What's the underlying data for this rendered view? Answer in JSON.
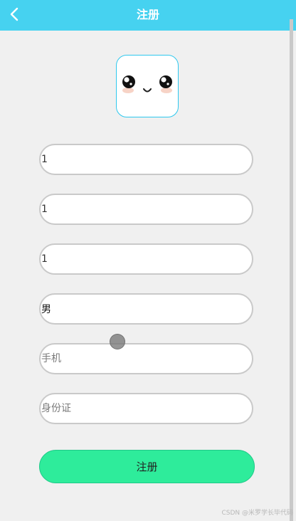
{
  "header": {
    "title": "注册",
    "background": "#46d2f0",
    "back_icon": "chevron-left-icon"
  },
  "avatar": {
    "icon": "cute-face-icon",
    "border_color": "#2ec8ee"
  },
  "form": {
    "fields": [
      {
        "value": "1",
        "placeholder": ""
      },
      {
        "value": "1",
        "placeholder": ""
      },
      {
        "value": "1",
        "placeholder": ""
      },
      {
        "value": "男",
        "placeholder": ""
      },
      {
        "value": "",
        "placeholder": "手机"
      },
      {
        "value": "",
        "placeholder": "身份证"
      }
    ],
    "submit_label": "注册",
    "submit_color": "#2eec9b"
  },
  "footer": {
    "watermark": "CSDN @米罗学长毕代码"
  }
}
